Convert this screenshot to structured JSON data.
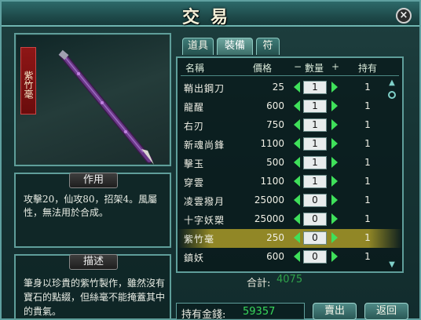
{
  "window": {
    "title": "交易",
    "close_icon": "×"
  },
  "item_preview": {
    "name": "紫竹毫"
  },
  "effect": {
    "tag": "作用",
    "text": "攻擊20，仙攻80，招架4。風屬性，無法用於合成。"
  },
  "description": {
    "tag": "描述",
    "text": "筆身以珍貴的紫竹製作，雖然沒有寶石的點綴，但絲毫不能掩蓋其中的貴氣。"
  },
  "tabs": [
    {
      "label": "道具",
      "active": false
    },
    {
      "label": "裝備",
      "active": true
    },
    {
      "label": "符",
      "active": false
    }
  ],
  "list": {
    "headers": {
      "name": "名稱",
      "price": "價格",
      "minus": "−",
      "qty": "數量",
      "plus": "+",
      "own": "持有"
    },
    "rows": [
      {
        "name": "鞘出鋼刀",
        "price": "25",
        "qty": "1",
        "own": "1"
      },
      {
        "name": "龍醒",
        "price": "600",
        "qty": "1",
        "own": "1"
      },
      {
        "name": "右刃",
        "price": "750",
        "qty": "1",
        "own": "1"
      },
      {
        "name": "新魂尚鋒",
        "price": "1100",
        "qty": "1",
        "own": "1"
      },
      {
        "name": "擊玉",
        "price": "500",
        "qty": "1",
        "own": "1"
      },
      {
        "name": "穿雲",
        "price": "1100",
        "qty": "1",
        "own": "1"
      },
      {
        "name": "凌雲撥月",
        "price": "25000",
        "qty": "0",
        "own": "1"
      },
      {
        "name": "十字妖槊",
        "price": "25000",
        "qty": "0",
        "own": "1"
      },
      {
        "name": "紫竹毫",
        "price": "250",
        "qty": "0",
        "own": "1",
        "selected": true
      },
      {
        "name": "鎮妖",
        "price": "600",
        "qty": "0",
        "own": "1"
      }
    ]
  },
  "total": {
    "label": "合計:",
    "value": "4075"
  },
  "money": {
    "label": "持有金錢:",
    "value": "59357"
  },
  "buttons": {
    "sell": "賣出",
    "back": "返回"
  },
  "colors": {
    "accent_green": "#3fe05a",
    "frame": "#5f9e9a",
    "selection": "#beaa28",
    "banner_red": "#8e1616"
  }
}
